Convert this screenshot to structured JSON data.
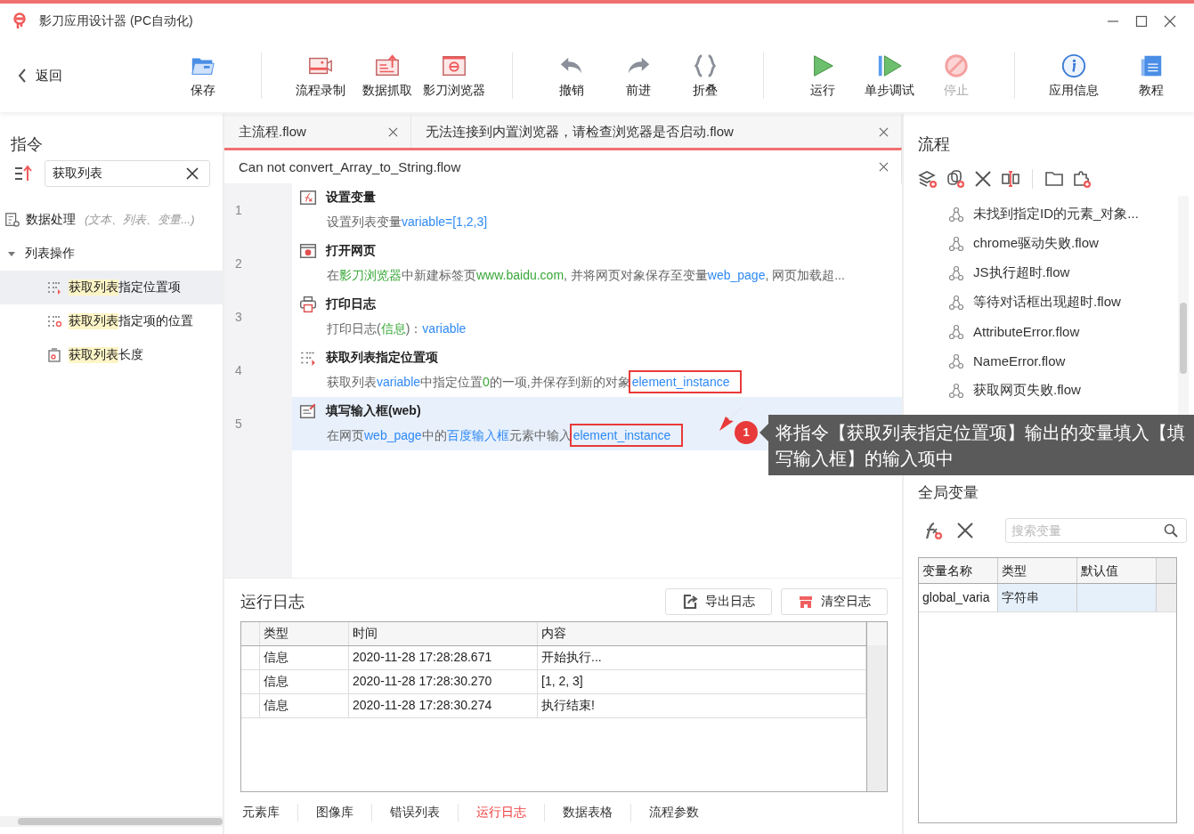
{
  "window": {
    "title": "影刀应用设计器 (PC自动化)"
  },
  "toolbar": {
    "back": "返回",
    "groups": [
      [
        {
          "kind": "save",
          "label": "保存",
          "disabled": false
        }
      ],
      [
        {
          "kind": "record",
          "label": "流程录制",
          "disabled": false
        },
        {
          "kind": "capture",
          "label": "数据抓取",
          "disabled": false
        },
        {
          "kind": "browser",
          "label": "影刀浏览器",
          "disabled": false
        }
      ],
      [
        {
          "kind": "undo",
          "label": "撤销",
          "disabled": false
        },
        {
          "kind": "redo",
          "label": "前进",
          "disabled": false
        },
        {
          "kind": "fold",
          "label": "折叠",
          "disabled": false
        }
      ],
      [
        {
          "kind": "run",
          "label": "运行",
          "disabled": false
        },
        {
          "kind": "step",
          "label": "单步调试",
          "disabled": false
        },
        {
          "kind": "stop",
          "label": "停止",
          "disabled": true
        }
      ],
      [
        {
          "kind": "info",
          "label": "应用信息",
          "disabled": false
        },
        {
          "kind": "tutorial",
          "label": "教程",
          "disabled": false
        }
      ]
    ]
  },
  "commands": {
    "title": "指令",
    "search": {
      "value": "获取列表"
    },
    "tree": [
      {
        "label": "数据处理",
        "hint": "(文本、列表、变量...)",
        "expanded": false
      },
      {
        "label": "列表操作",
        "expanded": true,
        "children": [
          {
            "kind": "list-item",
            "match": "获取列表",
            "rest": "指定位置项",
            "selected": true
          },
          {
            "kind": "list-index",
            "match": "获取列表",
            "rest": "指定项的位置",
            "selected": false
          },
          {
            "kind": "list-length",
            "match": "获取列表",
            "rest": "长度",
            "selected": false
          }
        ]
      }
    ]
  },
  "editor": {
    "tab_rows": [
      [
        {
          "label": "主流程.flow",
          "selected": false
        },
        {
          "label": "无法连接到内置浏览器，请检查浏览器是否启动.flow",
          "selected": false
        }
      ],
      [
        {
          "label": "Can not convert_Array_to_String.flow",
          "selected": true
        }
      ]
    ],
    "steps": [
      {
        "number": "1",
        "kind": "variable",
        "title": "设置变量",
        "selected": false,
        "description": [
          {
            "kind": "text",
            "text": "设置列表变量"
          },
          {
            "kind": "variable",
            "text": "variable=[1,2,3]"
          }
        ]
      },
      {
        "number": "2",
        "kind": "webpage",
        "title": "打开网页",
        "selected": false,
        "description": [
          {
            "kind": "text",
            "text": "在"
          },
          {
            "kind": "value",
            "text": "影刀浏览器"
          },
          {
            "kind": "text",
            "text": "中新建标签页"
          },
          {
            "kind": "value",
            "text": "www.baidu.com"
          },
          {
            "kind": "text",
            "text": ", 并将网页对象保存至变量"
          },
          {
            "kind": "variable",
            "text": "web_page"
          },
          {
            "kind": "text",
            "text": ", 网页加载超..."
          }
        ]
      },
      {
        "number": "3",
        "kind": "print",
        "title": "打印日志",
        "selected": false,
        "description": [
          {
            "kind": "text",
            "text": "打印日志("
          },
          {
            "kind": "value",
            "text": "信息"
          },
          {
            "kind": "text",
            "text": ")："
          },
          {
            "kind": "variable",
            "text": "variable"
          }
        ]
      },
      {
        "number": "4",
        "kind": "list-item",
        "title": "获取列表指定位置项",
        "selected": false,
        "description": [
          {
            "kind": "text",
            "text": "获取列表"
          },
          {
            "kind": "variable",
            "text": "variable"
          },
          {
            "kind": "text",
            "text": "中指定位置"
          },
          {
            "kind": "value",
            "text": "0"
          },
          {
            "kind": "text",
            "text": "的一项,并保存到新的对象"
          },
          {
            "kind": "boxed-variable",
            "text": "element_instance"
          }
        ]
      },
      {
        "number": "5",
        "kind": "input",
        "title": "填写输入框(web)",
        "selected": true,
        "description": [
          {
            "kind": "text",
            "text": "在网页"
          },
          {
            "kind": "variable",
            "text": "web_page"
          },
          {
            "kind": "text",
            "text": "中的"
          },
          {
            "kind": "variable",
            "text": "百度输入框"
          },
          {
            "kind": "text",
            "text": "元素中输入"
          },
          {
            "kind": "boxed-variable",
            "text": "element_instance"
          }
        ]
      }
    ],
    "callout": {
      "number": "1",
      "text": "将指令【获取列表指定位置项】输出的变量填入【填写输入框】的输入项中"
    }
  },
  "log": {
    "title": "运行日志",
    "buttons": [
      {
        "kind": "export",
        "label": "导出日志"
      },
      {
        "kind": "clear",
        "label": "清空日志"
      }
    ],
    "columns": [
      "类型",
      "时间",
      "内容"
    ],
    "rows": [
      [
        "信息",
        "2020-11-28 17:28:28.671",
        "开始执行..."
      ],
      [
        "信息",
        "2020-11-28 17:28:30.270",
        "[1, 2, 3]"
      ],
      [
        "信息",
        "2020-11-28 17:28:30.274",
        "执行结束!"
      ]
    ]
  },
  "bottom_tabs": [
    {
      "label": "元素库",
      "selected": false
    },
    {
      "label": "图像库",
      "selected": false
    },
    {
      "label": "错误列表",
      "selected": false
    },
    {
      "label": "运行日志",
      "selected": true
    },
    {
      "label": "数据表格",
      "selected": false
    },
    {
      "label": "流程参数",
      "selected": false
    }
  ],
  "flows": {
    "title": "流程",
    "items": [
      "未找到指定ID的元素_对象...",
      "chrome驱动失败.flow",
      "JS执行超时.flow",
      "等待对话框出现超时.flow",
      "AttributeError.flow",
      "NameError.flow",
      "获取网页失败.flow"
    ]
  },
  "globals": {
    "title": "全局变量",
    "search": {
      "placeholder": "搜索变量"
    },
    "columns": [
      "变量名称",
      "类型",
      "默认值"
    ],
    "rows": [
      [
        "global_varia",
        "字符串"
      ]
    ]
  }
}
